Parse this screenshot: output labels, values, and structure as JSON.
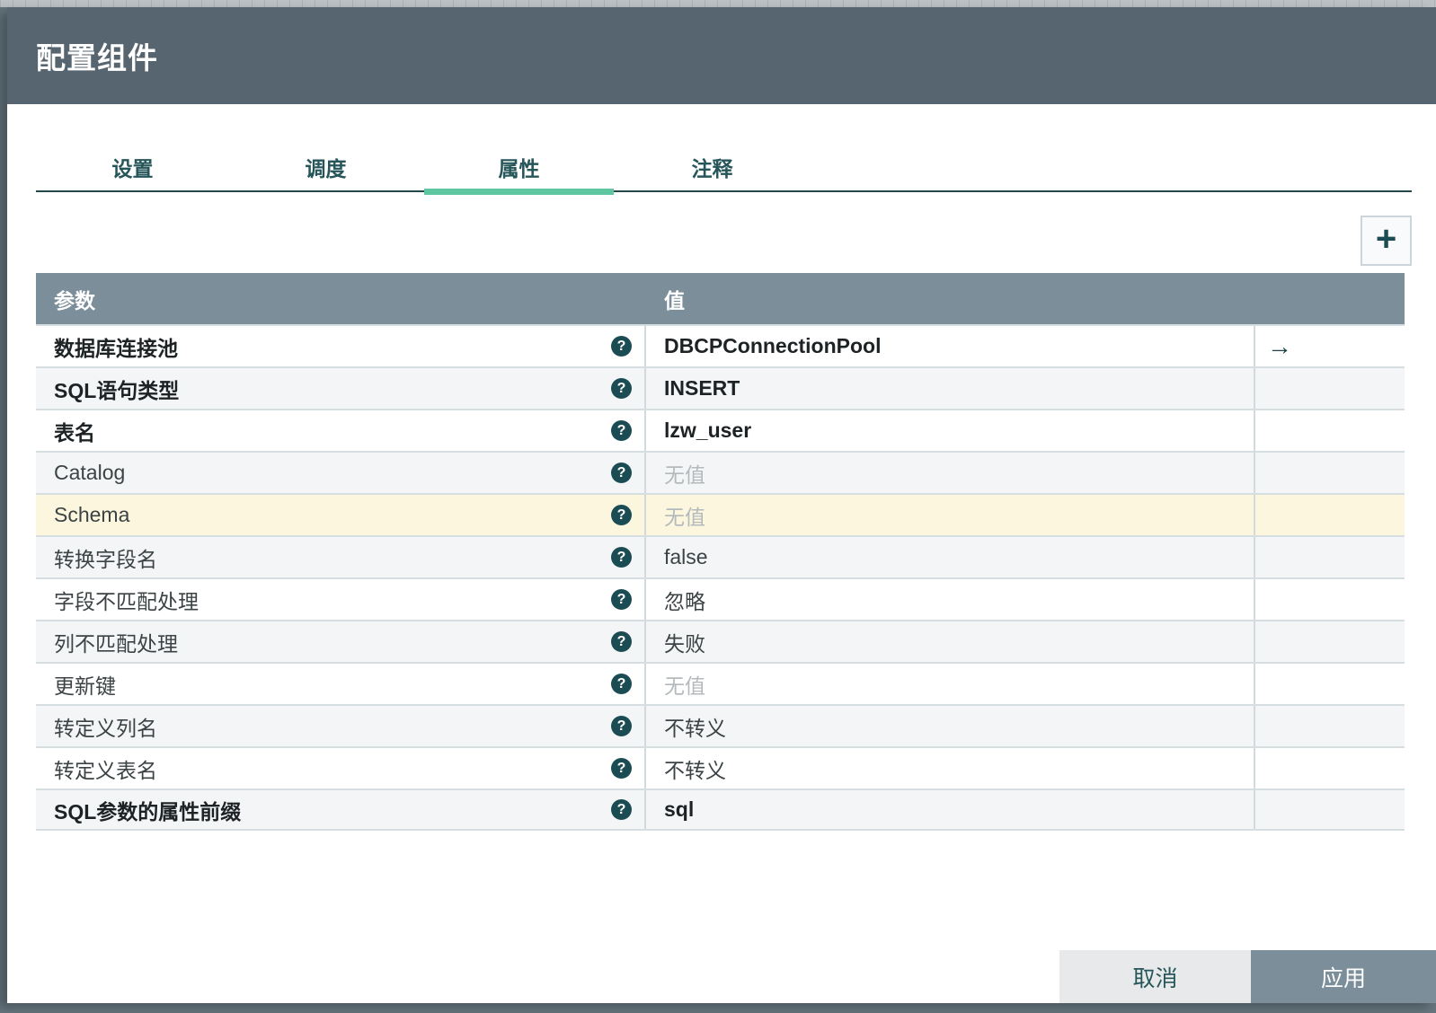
{
  "dialog": {
    "title": "配置组件"
  },
  "tabs": [
    {
      "label": "设置",
      "active": false
    },
    {
      "label": "调度",
      "active": false
    },
    {
      "label": "属性",
      "active": true
    },
    {
      "label": "注释",
      "active": false
    }
  ],
  "toolbar": {
    "add_label": "+"
  },
  "table": {
    "columns": [
      "参数",
      "值"
    ],
    "no_value_text": "无值",
    "rows": [
      {
        "name": "数据库连接池",
        "value": "DBCPConnectionPool",
        "bold": true,
        "no_value": false,
        "highlight": false,
        "has_arrow": true
      },
      {
        "name": "SQL语句类型",
        "value": "INSERT",
        "bold": true,
        "no_value": false,
        "highlight": false,
        "has_arrow": false
      },
      {
        "name": "表名",
        "value": "lzw_user",
        "bold": true,
        "no_value": false,
        "highlight": false,
        "has_arrow": false
      },
      {
        "name": "Catalog",
        "value": "无值",
        "bold": false,
        "no_value": true,
        "highlight": false,
        "has_arrow": false
      },
      {
        "name": "Schema",
        "value": "无值",
        "bold": false,
        "no_value": true,
        "highlight": true,
        "has_arrow": false
      },
      {
        "name": "转换字段名",
        "value": "false",
        "bold": false,
        "no_value": false,
        "highlight": false,
        "has_arrow": false
      },
      {
        "name": "字段不匹配处理",
        "value": "忽略",
        "bold": false,
        "no_value": false,
        "highlight": false,
        "has_arrow": false
      },
      {
        "name": "列不匹配处理",
        "value": "失败",
        "bold": false,
        "no_value": false,
        "highlight": false,
        "has_arrow": false
      },
      {
        "name": "更新键",
        "value": "无值",
        "bold": false,
        "no_value": true,
        "highlight": false,
        "has_arrow": false
      },
      {
        "name": "转定义列名",
        "value": "不转义",
        "bold": false,
        "no_value": false,
        "highlight": false,
        "has_arrow": false
      },
      {
        "name": "转定义表名",
        "value": "不转义",
        "bold": false,
        "no_value": false,
        "highlight": false,
        "has_arrow": false
      },
      {
        "name": "SQL参数的属性前缀",
        "value": "sql",
        "bold": true,
        "no_value": false,
        "highlight": false,
        "has_arrow": false
      }
    ],
    "help_icon_glyph": "?",
    "arrow_glyph": "→"
  },
  "footer": {
    "cancel_label": "取消",
    "apply_label": "应用"
  },
  "colors": {
    "titlebar_bg": "#56656f",
    "accent_green": "#5ec7a2",
    "tab_text": "#26565a",
    "table_header_bg": "#7b8e99",
    "row_alt_bg": "#f3f5f6",
    "row_highlight_bg": "#fcf6df",
    "no_value_text": "#b4babc",
    "help_icon_bg": "#1c4c53",
    "cancel_bg": "#e7e9ea",
    "apply_bg": "#7b8e99",
    "page_bg": "#66757f"
  }
}
